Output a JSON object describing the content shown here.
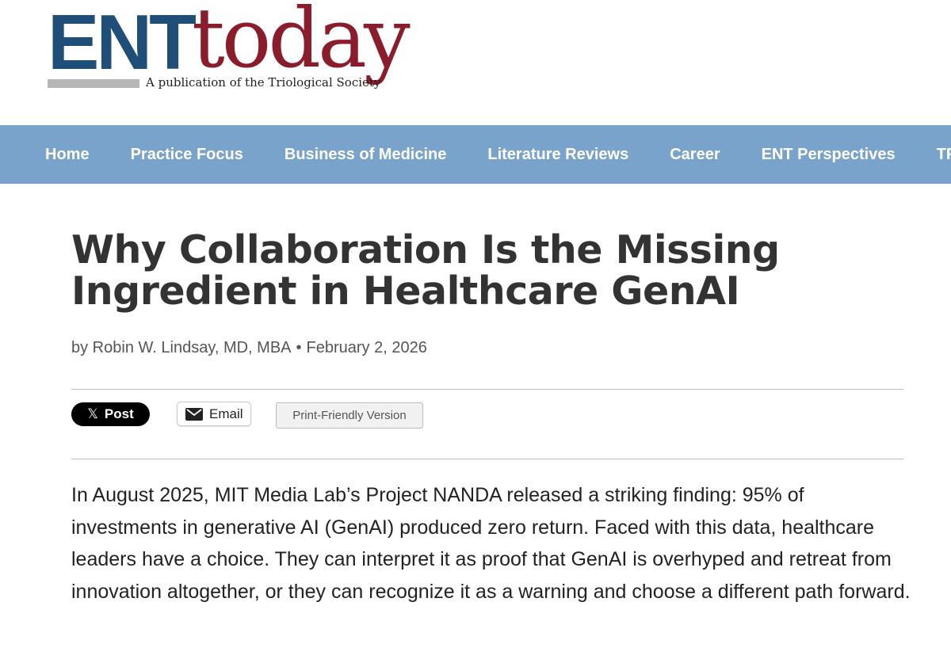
{
  "logo": {
    "ent": "ENT",
    "today": "today",
    "tagline": "A publication of the Triological Society"
  },
  "nav": {
    "items": [
      {
        "label": "Home"
      },
      {
        "label": "Practice Focus"
      },
      {
        "label": "Business of Medicine"
      },
      {
        "label": "Literature Reviews"
      },
      {
        "label": "Career"
      },
      {
        "label": "ENT Perspectives"
      },
      {
        "label": "TRIO"
      }
    ]
  },
  "article": {
    "title": "Why Collaboration Is the Missing Ingredient in Healthcare GenAI",
    "byline_prefix": "by Robin W. Lindsay, MD, MBA",
    "byline_separator": "•",
    "date": "February 2, 2026",
    "body": "In August 2025, MIT Media Lab’s Project NANDA released a striking finding: 95% of investments in generative AI (GenAI) produced zero return. Faced with this data, healthcare leaders have a choice. They can interpret it as proof that GenAI is overhyped and retreat from innovation altogether, or they can recognize it as a warning and choose a different path forward."
  },
  "share": {
    "x_label": "Post",
    "x_icon": "x-logo-icon",
    "email_label": "Email",
    "email_icon": "envelope-icon",
    "print_label": "Print-Friendly Version"
  },
  "colors": {
    "ent_blue": "#1f4e79",
    "today_red": "#8a1c2b",
    "nav_bg": "#7aa3cb",
    "title_text": "#333333"
  }
}
